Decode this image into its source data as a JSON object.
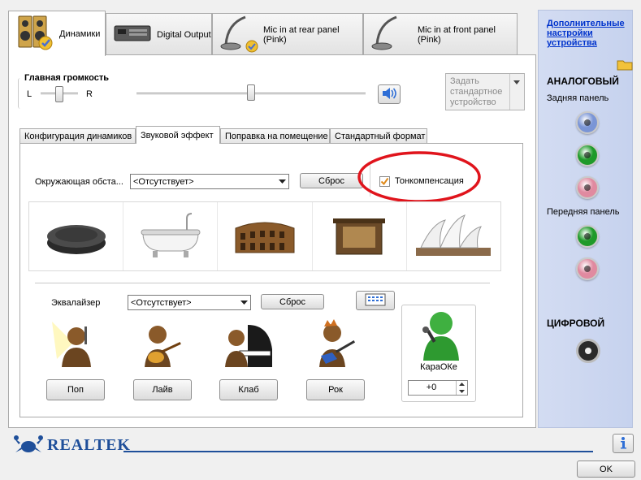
{
  "tabs": {
    "speakers": "Динамики",
    "digital_output": "Digital Output",
    "mic_rear": "Mic in at rear panel (Pink)",
    "mic_front": "Mic in at front panel (Pink)"
  },
  "master_volume": {
    "label": "Главная громкость",
    "left": "L",
    "right": "R",
    "balance": 0.5,
    "level": 0.5
  },
  "default_device_button": "Задать стандартное устройство",
  "sub_tabs": {
    "speaker_config": "Конфигурация динамиков",
    "sound_effect": "Звуковой эффект",
    "room_correction": "Поправка на помещение",
    "default_format": "Стандартный формат"
  },
  "environment": {
    "label": "Окружающая обста...",
    "value": "<Отсутствует>",
    "reset": "Сброс",
    "loudness_label": "Тонкомпенсация",
    "loudness_checked": true
  },
  "equalizer": {
    "label": "Эквалайзер",
    "value": "<Отсутствует>",
    "reset": "Сброс",
    "presets": [
      "Поп",
      "Лайв",
      "Клаб",
      "Рок"
    ]
  },
  "karaoke": {
    "label": "КараОКе",
    "value": "+0"
  },
  "right_panel": {
    "advanced_link": "Дополнительные настройки устройства",
    "analog_title": "АНАЛОГОВЫЙ",
    "rear_panel": "Задняя панель",
    "front_panel": "Передняя панель",
    "digital_title": "ЦИФРОВОЙ"
  },
  "footer": {
    "brand": "REALTEK",
    "ok": "OK"
  },
  "colors": {
    "highlight_ring": "#e0141c",
    "link": "#0033cc",
    "jack_blue": "#7a95d6",
    "jack_green": "#1f9a2a",
    "jack_pink": "#e08aa0",
    "brand_blue": "#1f4f9a"
  }
}
